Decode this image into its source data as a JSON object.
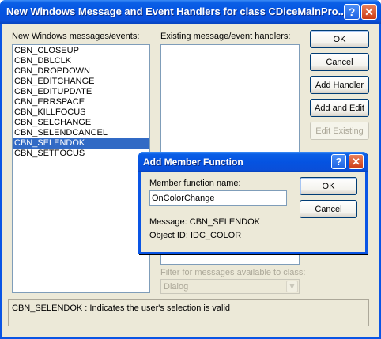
{
  "window": {
    "title": "New Windows Message and Event Handlers for class CDiceMainPro..."
  },
  "caption_buttons": {
    "help": "?",
    "close": "✕"
  },
  "left_list": {
    "label": "New Windows messages/events:",
    "items": [
      "CBN_CLOSEUP",
      "CBN_DBLCLK",
      "CBN_DROPDOWN",
      "CBN_EDITCHANGE",
      "CBN_EDITUPDATE",
      "CBN_ERRSPACE",
      "CBN_KILLFOCUS",
      "CBN_SELCHANGE",
      "CBN_SELENDCANCEL",
      "CBN_SELENDOK",
      "CBN_SETFOCUS"
    ],
    "selected": "CBN_SELENDOK"
  },
  "right_list": {
    "label": "Existing message/event handlers:"
  },
  "buttons": {
    "ok": "OK",
    "cancel": "Cancel",
    "add_handler": "Add Handler",
    "add_and_edit": "Add and Edit",
    "edit_existing": "Edit Existing"
  },
  "filter": {
    "label": "Filter for messages available to class:",
    "value": "Dialog"
  },
  "status_text": "CBN_SELENDOK :  Indicates the user's selection is valid",
  "dialog": {
    "title": "Add Member Function",
    "name_label": "Member function name:",
    "name_value": "OnColorChange",
    "ok": "OK",
    "cancel": "Cancel",
    "message_line": "Message: CBN_SELENDOK",
    "object_line": "Object ID: IDC_COLOR"
  },
  "colors": {
    "title_blue": "#0553e1",
    "selection": "#316ac5",
    "face": "#ece9d8",
    "close_red": "#cc3a14"
  }
}
